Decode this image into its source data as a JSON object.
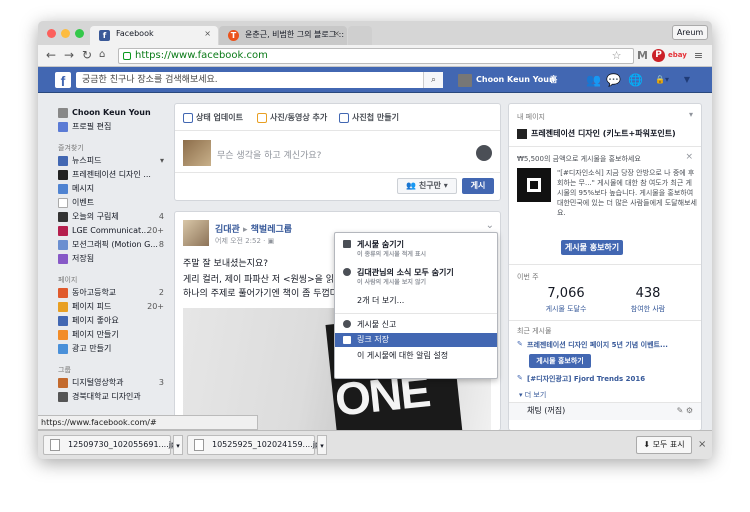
{
  "browser": {
    "tabs": [
      {
        "title": "Facebook",
        "favicon": "facebook-f",
        "active": true
      },
      {
        "title": "윤춘근, 비범한 그의 블로그 :: 로",
        "favicon": "tistory-t",
        "active": false
      }
    ],
    "profile_button": "Areum",
    "url": "https://www.facebook.com",
    "status_url": "https://www.facebook.com/#"
  },
  "fb_header": {
    "logo": "f",
    "search_placeholder": "궁금한 친구나 장소를 검색해보세요.",
    "user_name": "Choon Keun Youn",
    "home_label": "홈"
  },
  "left_nav": {
    "profile": [
      {
        "label": "Choon Keun Youn"
      },
      {
        "label": "프로필 편집"
      }
    ],
    "favorites_title": "즐겨찾기",
    "favorites": [
      {
        "label": "뉴스피드",
        "count": "▾"
      },
      {
        "label": "프레젠테이션 디자인 ...",
        "count": ""
      },
      {
        "label": "메시지",
        "count": ""
      },
      {
        "label": "이벤트",
        "count": ""
      },
      {
        "label": "오늘의 구림체",
        "count": "4"
      },
      {
        "label": "LGE Communicat...",
        "count": "20+"
      },
      {
        "label": "모션그래픽 (Motion G...",
        "count": "8"
      },
      {
        "label": "저장됨",
        "count": ""
      }
    ],
    "pages_title": "페이지",
    "pages": [
      {
        "label": "동아고등학교",
        "count": "2"
      },
      {
        "label": "페이지 피드",
        "count": "20+"
      },
      {
        "label": "페이지 좋아요",
        "count": ""
      },
      {
        "label": "페이지 만들기",
        "count": ""
      },
      {
        "label": "광고 만들기",
        "count": ""
      }
    ],
    "groups_title": "그룹",
    "groups": [
      {
        "label": "디지털영상학과",
        "count": "3"
      },
      {
        "label": "경북대학교 디자인과",
        "count": ""
      }
    ]
  },
  "composer": {
    "tab_status": "상태 업데이트",
    "tab_photo": "사진/동영상 추가",
    "tab_album": "사진첩 만들기",
    "placeholder": "무슨 생각을 하고 계신가요?",
    "audience": "친구만 ▾",
    "post_button": "게시"
  },
  "post": {
    "author": "김대관",
    "arrow": "▸",
    "page": "책벌레그룹",
    "time": "어제 오전 2:52 · ",
    "line1": "주말 잘 보내셨는지요?",
    "line2": "게리 컬러, 제이 파파산 저 <원씽>을 읽으",
    "line3": "하나의 주제로 풀어가기엔 책이 좀 두껍다",
    "photo_text": "ONE"
  },
  "post_menu": {
    "items": [
      {
        "label": "게시물 숨기기",
        "sub": "이 종류의 게시물 적게 표시",
        "bold": true
      },
      {
        "label": "김대관님의 소식 모두 숨기기",
        "sub": "이 사람의 게시물 보지 않기",
        "bold": true
      },
      {
        "label": "2개 더 보기...",
        "sub": "",
        "bold": false
      },
      {
        "label": "게시물 신고",
        "sub": "",
        "bold": false
      },
      {
        "label": "링크 저장",
        "sub": "",
        "bold": false
      },
      {
        "label": "이 게시물에 대한 알림 설정",
        "sub": "",
        "bold": false
      }
    ]
  },
  "right_col": {
    "my_pages_title": "내 페이지",
    "page_name": "프레젠테이션 디자인 (키노트+파워포인트)",
    "promo_title": "₩5,500의 금액으로 게시물을 홍보하세요",
    "promo_text": "\"[#디자인소식] 지금 당장 안방으로 나 중에 후회하는 무...\" 게시물에 대한 참 여도가 최근 게시물의 95%보다 높습니다. 게시물을 홍보하여 대한민국에 있는 더 많은 사람들에게 도달해보세요.",
    "promo_button": "게시물 홍보하기",
    "week_title": "이번 주",
    "stat1_value": "7,066",
    "stat1_label": "게시물 도달수",
    "stat2_value": "438",
    "stat2_label": "참여한 사람",
    "recent_title": "최근 게시물",
    "recent1": "프레젠테이션 디자인 페이지 5년 기념 이벤트...",
    "recent_button": "게시물 홍보하기",
    "recent2": "[#디자인광고] Fjord Trends 2016",
    "more": "▾ 더 보기",
    "chat": "채팅 (꺼짐)"
  },
  "downloads": {
    "items": [
      {
        "name": "12509730_102055691....jpg"
      },
      {
        "name": "10525925_102024159....jpg"
      }
    ],
    "show_all": "모두 표시",
    "close": "×"
  }
}
